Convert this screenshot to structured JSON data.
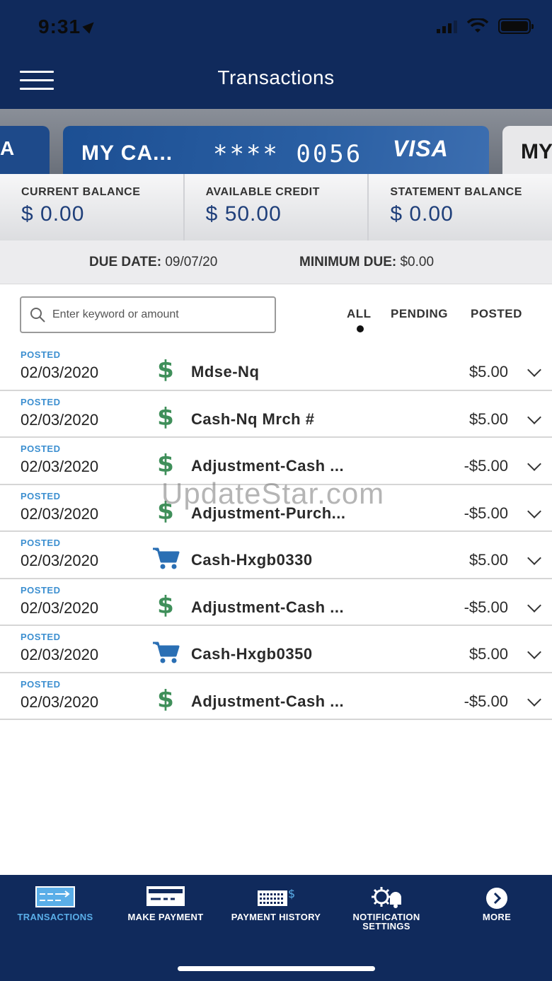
{
  "status_bar": {
    "time": "9:31"
  },
  "header": {
    "title": "Transactions"
  },
  "cards": {
    "prev_label": "A",
    "main": {
      "name": "MY CA...",
      "number": "**** 0056",
      "brand": "VISA"
    },
    "next_label": "MY"
  },
  "balances": [
    {
      "label": "CURRENT BALANCE",
      "value": "$ 0.00"
    },
    {
      "label": "AVAILABLE CREDIT",
      "value": "$ 50.00"
    },
    {
      "label": "STATEMENT BALANCE",
      "value": "$ 0.00"
    }
  ],
  "due": {
    "date_label": "DUE DATE:",
    "date_value": "09/07/20",
    "min_label": "MINIMUM DUE:",
    "min_value": "$0.00"
  },
  "search": {
    "placeholder": "Enter keyword or amount"
  },
  "filters": {
    "all": "ALL",
    "pending": "PENDING",
    "posted": "POSTED",
    "active": "all"
  },
  "transactions": [
    {
      "status": "POSTED",
      "date": "02/03/2020",
      "icon": "dollar-icon",
      "description": "Mdse-Nq",
      "amount": "$5.00"
    },
    {
      "status": "POSTED",
      "date": "02/03/2020",
      "icon": "dollar-icon",
      "description": "Cash-Nq Mrch #",
      "amount": "$5.00"
    },
    {
      "status": "POSTED",
      "date": "02/03/2020",
      "icon": "dollar-icon",
      "description": "Adjustment-Cash ...",
      "amount": "-$5.00"
    },
    {
      "status": "POSTED",
      "date": "02/03/2020",
      "icon": "dollar-icon",
      "description": "Adjustment-Purch...",
      "amount": "-$5.00"
    },
    {
      "status": "POSTED",
      "date": "02/03/2020",
      "icon": "cart-icon",
      "description": "Cash-Hxgb0330",
      "amount": "$5.00"
    },
    {
      "status": "POSTED",
      "date": "02/03/2020",
      "icon": "dollar-icon",
      "description": "Adjustment-Cash ...",
      "amount": "-$5.00"
    },
    {
      "status": "POSTED",
      "date": "02/03/2020",
      "icon": "cart-icon",
      "description": "Cash-Hxgb0350",
      "amount": "$5.00"
    },
    {
      "status": "POSTED",
      "date": "02/03/2020",
      "icon": "dollar-icon",
      "description": "Adjustment-Cash ...",
      "amount": "-$5.00"
    }
  ],
  "watermark": "UpdateStar.com",
  "tabs": [
    {
      "label": "TRANSACTIONS",
      "icon": "transactions-icon",
      "active": true
    },
    {
      "label": "MAKE PAYMENT",
      "icon": "payment-card-icon",
      "active": false
    },
    {
      "label": "PAYMENT HISTORY",
      "icon": "calendar-dollar-icon",
      "active": false
    },
    {
      "label": "NOTIFICATION SETTINGS",
      "icon": "gear-bell-icon",
      "active": false
    },
    {
      "label": "MORE",
      "icon": "chevron-circle-icon",
      "active": false
    }
  ],
  "colors": {
    "header_bg": "#102a5c",
    "posted_blue": "#3c8fd0",
    "dollar_green": "#3f8f5a",
    "cart_blue": "#2a6fb4",
    "active_tab": "#5aaee8",
    "balance_value": "#1f3f7a"
  }
}
